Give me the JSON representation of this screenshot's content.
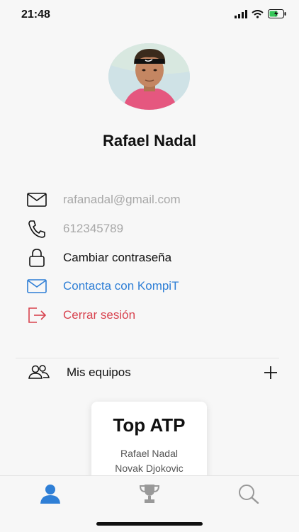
{
  "status_bar": {
    "time": "21:48"
  },
  "profile": {
    "name": "Rafael Nadal",
    "avatar": "player-photo"
  },
  "menu": {
    "email": {
      "label": "rafanadal@gmail.com",
      "icon": "mail-icon"
    },
    "phone": {
      "label": "612345789",
      "icon": "phone-icon"
    },
    "password": {
      "label": "Cambiar contraseña",
      "icon": "lock-icon"
    },
    "contact": {
      "label": "Contacta con KompiT",
      "icon": "mail-icon",
      "color": "#2f7fd6"
    },
    "logout": {
      "label": "Cerrar sesión",
      "icon": "logout-icon",
      "color": "#d8434f"
    }
  },
  "teams": {
    "label": "Mis equipos",
    "icon": "users-icon",
    "action_icon": "plus-icon"
  },
  "card": {
    "title": "Top ATP",
    "players": [
      "Rafael Nadal",
      "Novak Djokovic"
    ]
  },
  "tabs": [
    {
      "name": "profile",
      "icon": "person-icon",
      "active": true,
      "color": "#2f7fd6"
    },
    {
      "name": "trophy",
      "icon": "trophy-icon",
      "active": false,
      "color": "#999999"
    },
    {
      "name": "search",
      "icon": "search-icon",
      "active": false,
      "color": "#999999"
    }
  ]
}
